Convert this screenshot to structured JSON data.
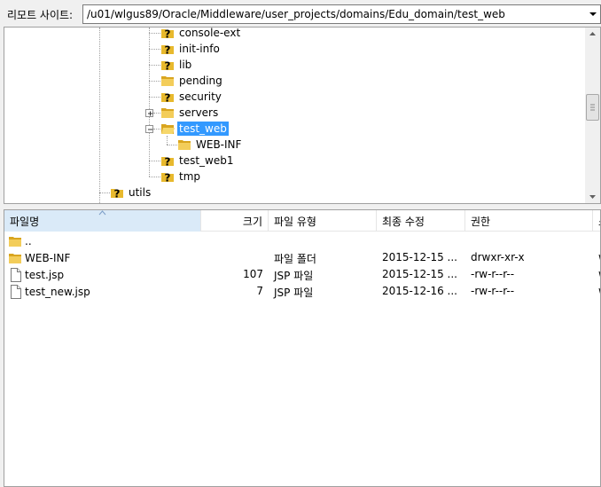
{
  "remote_site": {
    "label": "리모트 사이트:",
    "path": "/u01/wlgus89/Oracle/Middleware/user_projects/domains/Edu_domain/test_web"
  },
  "tree": {
    "nodes": [
      {
        "label": "console-ext",
        "icon": "unknown-folder-icon"
      },
      {
        "label": "init-info",
        "icon": "unknown-folder-icon"
      },
      {
        "label": "lib",
        "icon": "unknown-folder-icon"
      },
      {
        "label": "pending",
        "icon": "folder-icon"
      },
      {
        "label": "security",
        "icon": "unknown-folder-icon"
      },
      {
        "label": "servers",
        "icon": "folder-icon"
      },
      {
        "label": "test_web",
        "icon": "open-folder-icon"
      },
      {
        "label": "WEB-INF",
        "icon": "folder-icon"
      },
      {
        "label": "test_web1",
        "icon": "unknown-folder-icon"
      },
      {
        "label": "tmp",
        "icon": "unknown-folder-icon"
      },
      {
        "label": "utils",
        "icon": "unknown-folder-icon"
      }
    ]
  },
  "list": {
    "columns": {
      "name": "파일명",
      "size": "크기",
      "type": "파일 유형",
      "modified": "최종 수정",
      "perms": "권한",
      "owner": "소"
    },
    "rows": [
      {
        "name": "..",
        "size": "",
        "type": "",
        "modified": "",
        "perms": "",
        "owner": "",
        "icon": "folder-icon"
      },
      {
        "name": "WEB-INF",
        "size": "",
        "type": "파일 폴더",
        "modified": "2015-12-15 ...",
        "perms": "drwxr-xr-x",
        "owner": "w",
        "icon": "folder-icon"
      },
      {
        "name": "test.jsp",
        "size": "107",
        "type": "JSP 파일",
        "modified": "2015-12-15 ...",
        "perms": "-rw-r--r--",
        "owner": "w",
        "icon": "file-icon"
      },
      {
        "name": "test_new.jsp",
        "size": "7",
        "type": "JSP 파일",
        "modified": "2015-12-16 ...",
        "perms": "-rw-r--r--",
        "owner": "w",
        "icon": "file-icon"
      }
    ]
  },
  "colors": {
    "selection": "#3399ff",
    "folder": "#e8b92d",
    "sorted_header": "#daeaf8"
  }
}
